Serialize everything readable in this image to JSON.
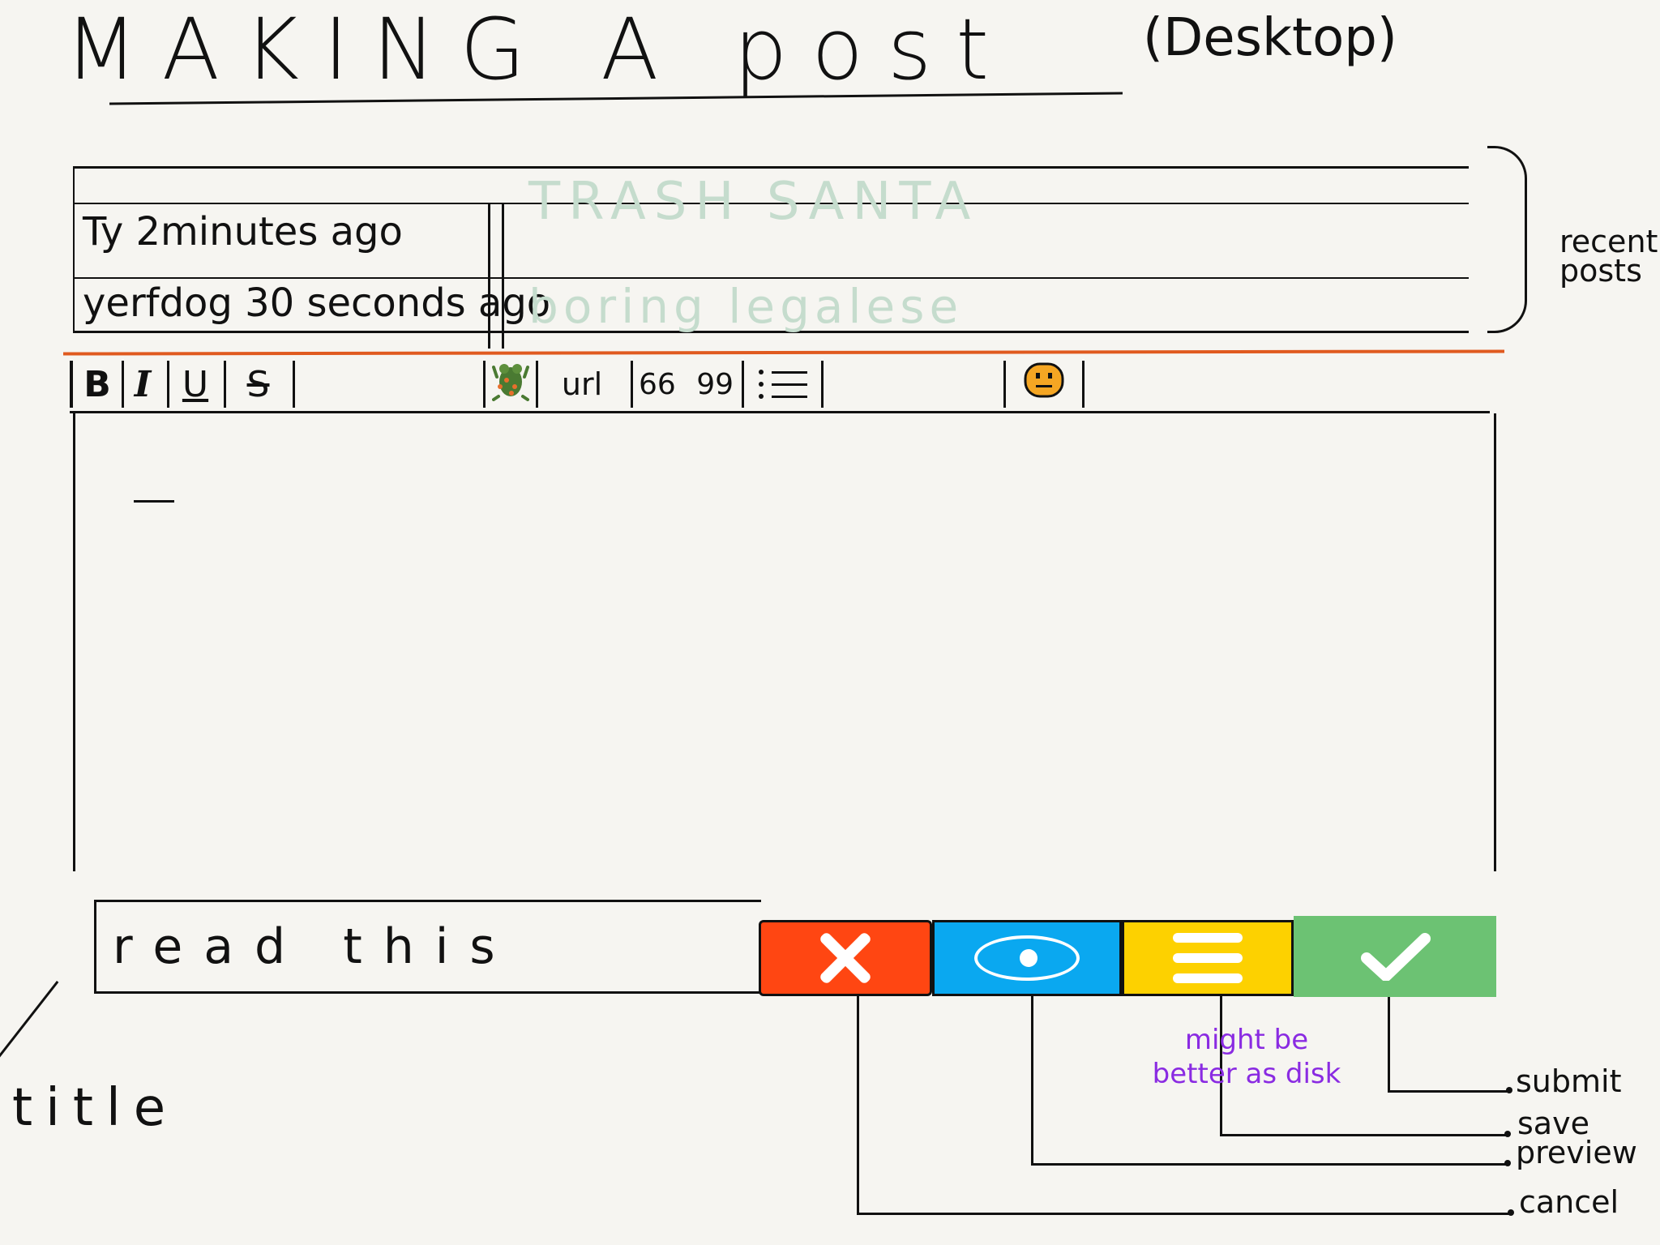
{
  "header": {
    "title": "MAKING A post",
    "subtitle": "(Desktop)"
  },
  "recent_posts": {
    "label": "recent posts",
    "items": [
      {
        "meta": "Ty 2minutes ago",
        "title": "TRASH SANTA"
      },
      {
        "meta": "yerfdog 30 seconds ago",
        "title": "boring legalese"
      }
    ]
  },
  "toolbar": {
    "bold": "B",
    "italic": "I",
    "underline": "U",
    "strikethrough": "S",
    "url": "url",
    "quote_open": "66",
    "quote_close": "99"
  },
  "post_title": {
    "value": "read this"
  },
  "annotations": {
    "title_field": "title",
    "submit": "submit",
    "save": "save",
    "preview": "preview",
    "cancel": "cancel",
    "note": "might be better as disk"
  },
  "colors": {
    "cancel": "#ff4612",
    "preview": "#0aa8f0",
    "save": "#fdd100",
    "submit": "#6cc273",
    "separator": "#e05a1f",
    "recent_title_text": "#c5dccd",
    "note": "#8a2be2"
  },
  "icons": {
    "cancel": "close-icon",
    "preview": "eye-icon",
    "save": "menu-icon",
    "submit": "check-icon",
    "image": "frog-image-icon",
    "emoji": "neutral-face-icon",
    "list": "list-icon"
  }
}
